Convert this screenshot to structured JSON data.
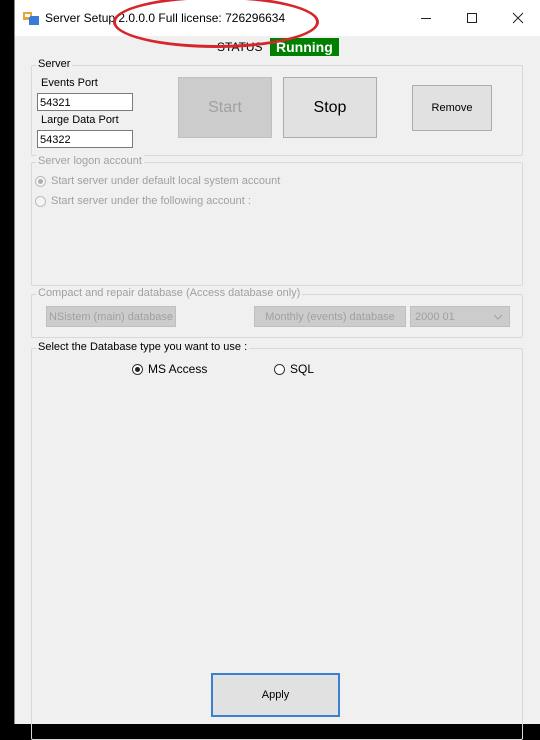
{
  "window": {
    "title": "Server Setup 2.0.0.0 Full license: 726296634",
    "min_icon": "minimize-icon",
    "max_icon": "maximize-icon",
    "close_icon": "close-icon"
  },
  "status": {
    "label": "STATUS",
    "value": "Running",
    "color": "#008000"
  },
  "server_group": {
    "title": "Server",
    "events_port_label": "Events Port",
    "events_port_value": "54321",
    "large_data_port_label": "Large Data Port",
    "large_data_port_value": "54322",
    "start_label": "Start",
    "stop_label": "Stop",
    "remove_label": "Remove"
  },
  "logon_group": {
    "title": "Server logon account",
    "option_default": "Start server under default local system account",
    "option_following": "Start server under the following account :"
  },
  "compact_group": {
    "title": "Compact and repair database (Access database only)",
    "main_db_label": "NSistem (main) database",
    "monthly_db_label": "Monthly (events) database",
    "month_select_value": "2000 01"
  },
  "db_type_group": {
    "title": "Select the Database type you want to use :",
    "option_access": "MS Access",
    "option_sql": "SQL"
  },
  "apply_label": "Apply",
  "annotation_color": "#d6262b"
}
